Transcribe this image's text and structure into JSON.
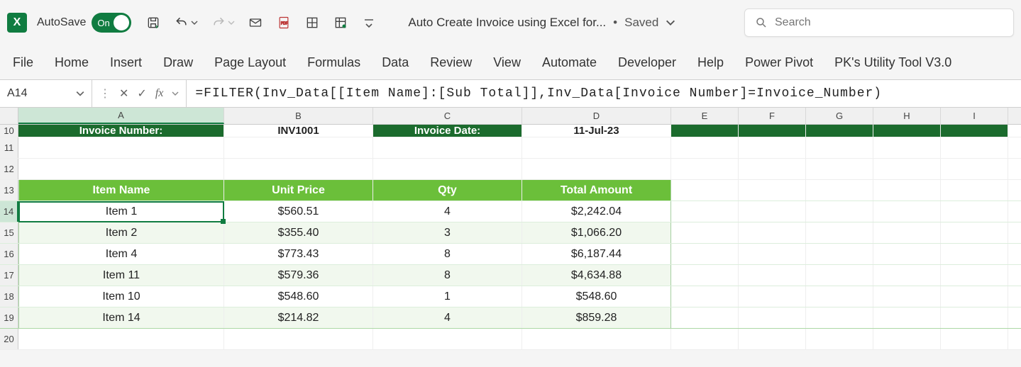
{
  "titlebar": {
    "autosave_label": "AutoSave",
    "autosave_on": "On",
    "doc_title": "Auto Create Invoice using Excel for...",
    "saved_status": "Saved",
    "search_placeholder": "Search"
  },
  "ribbon": {
    "tabs": [
      "File",
      "Home",
      "Insert",
      "Draw",
      "Page Layout",
      "Formulas",
      "Data",
      "Review",
      "View",
      "Automate",
      "Developer",
      "Help",
      "Power Pivot",
      "PK's Utility Tool V3.0"
    ]
  },
  "formula_bar": {
    "namebox": "A14",
    "formula": "=FILTER(Inv_Data[[Item Name]:[Sub Total]],Inv_Data[Invoice Number]=Invoice_Number)"
  },
  "columns": [
    "A",
    "B",
    "C",
    "D",
    "E",
    "F",
    "G",
    "H",
    "I"
  ],
  "row_numbers": [
    "10",
    "11",
    "12",
    "13",
    "14",
    "15",
    "16",
    "17",
    "18",
    "19",
    "20"
  ],
  "invoice_header": {
    "label_number": "Invoice Number:",
    "value_number": "INV1001",
    "label_date": "Invoice Date:",
    "value_date": "11-Jul-23"
  },
  "table": {
    "headers": [
      "Item Name",
      "Unit Price",
      "Qty",
      "Total Amount"
    ],
    "rows": [
      {
        "item": "Item 1",
        "price": "$560.51",
        "qty": "4",
        "total": "$2,242.04"
      },
      {
        "item": "Item 2",
        "price": "$355.40",
        "qty": "3",
        "total": "$1,066.20"
      },
      {
        "item": "Item 4",
        "price": "$773.43",
        "qty": "8",
        "total": "$6,187.44"
      },
      {
        "item": "Item 11",
        "price": "$579.36",
        "qty": "8",
        "total": "$4,634.88"
      },
      {
        "item": "Item 10",
        "price": "$548.60",
        "qty": "1",
        "total": "$548.60"
      },
      {
        "item": "Item 14",
        "price": "$214.82",
        "qty": "4",
        "total": "$859.28"
      }
    ]
  }
}
